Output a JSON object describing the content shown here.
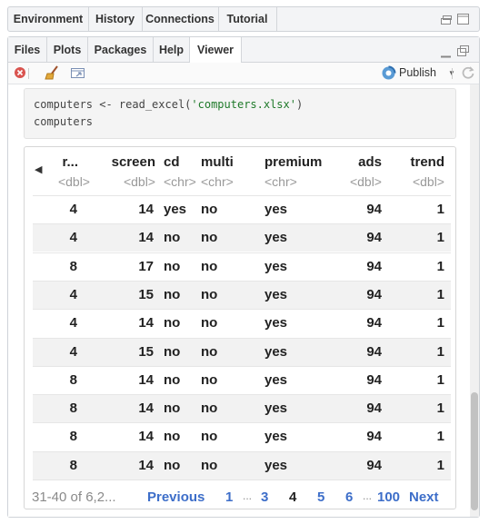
{
  "top_tabs": [
    "Environment",
    "History",
    "Connections",
    "Tutorial"
  ],
  "bottom_tabs": [
    "Files",
    "Plots",
    "Packages",
    "Help",
    "Viewer"
  ],
  "active_tab": "Viewer",
  "toolbar": {
    "publish_label": "Publish"
  },
  "code": {
    "line1_prefix": "computers <- read_excel(",
    "line1_string": "'computers.xlsx'",
    "line1_suffix": ")",
    "line2": "computers"
  },
  "table": {
    "columns": [
      {
        "name": "r...",
        "type": "<dbl>"
      },
      {
        "name": "screen",
        "type": "<dbl>"
      },
      {
        "name": "cd",
        "type": "<chr>"
      },
      {
        "name": "multi",
        "type": "<chr>"
      },
      {
        "name": "premium",
        "type": "<chr>"
      },
      {
        "name": "ads",
        "type": "<dbl>"
      },
      {
        "name": "trend",
        "type": "<dbl>"
      }
    ],
    "rows": [
      [
        "4",
        "14",
        "yes",
        "no",
        "yes",
        "94",
        "1"
      ],
      [
        "4",
        "14",
        "no",
        "no",
        "yes",
        "94",
        "1"
      ],
      [
        "8",
        "17",
        "no",
        "no",
        "yes",
        "94",
        "1"
      ],
      [
        "4",
        "15",
        "no",
        "no",
        "yes",
        "94",
        "1"
      ],
      [
        "4",
        "14",
        "no",
        "no",
        "yes",
        "94",
        "1"
      ],
      [
        "4",
        "15",
        "no",
        "no",
        "yes",
        "94",
        "1"
      ],
      [
        "8",
        "14",
        "no",
        "no",
        "yes",
        "94",
        "1"
      ],
      [
        "8",
        "14",
        "no",
        "no",
        "yes",
        "94",
        "1"
      ],
      [
        "8",
        "14",
        "no",
        "no",
        "yes",
        "94",
        "1"
      ],
      [
        "8",
        "14",
        "no",
        "no",
        "yes",
        "94",
        "1"
      ]
    ]
  },
  "pagination": {
    "range": "31-40 of 6,2...",
    "previous": "Previous",
    "p1": "1",
    "ellipsis1": "...",
    "p3": "3",
    "current": "4",
    "p5": "5",
    "p6": "6",
    "ellipsis2": "...",
    "p100": "100",
    "next": "Next"
  },
  "colors": {
    "link": "#3d6ec9",
    "muted": "#999999",
    "stripe": "#f2f2f2"
  }
}
